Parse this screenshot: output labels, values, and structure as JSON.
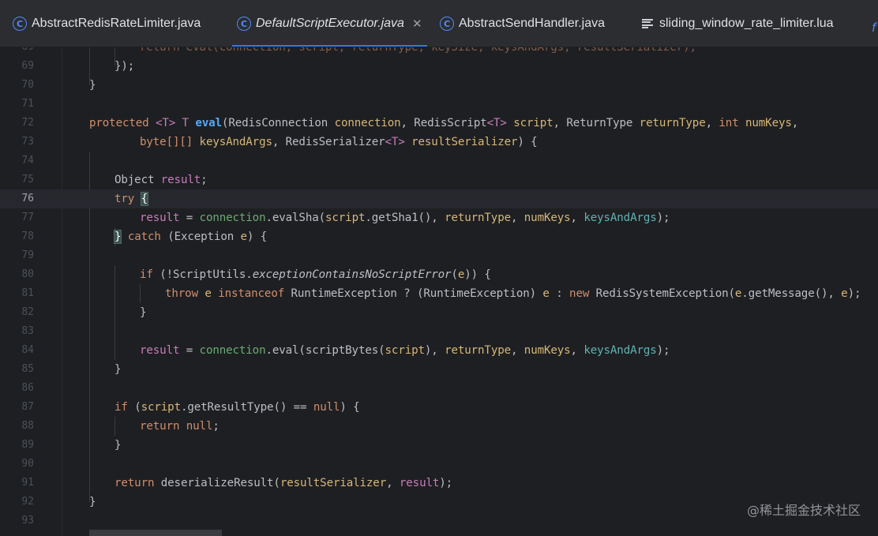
{
  "tabs": [
    {
      "label": "AbstractRedisRateLimiter.java",
      "icon": "java-class-icon"
    },
    {
      "label": "DefaultScriptExecutor.java",
      "icon": "java-class-icon",
      "active": true
    },
    {
      "label": "AbstractSendHandler.java",
      "icon": "java-class-icon"
    },
    {
      "label": "sliding_window_rate_limiter.lua",
      "icon": "text-file-icon"
    }
  ],
  "close_glyph": "✕",
  "line_numbers": [
    "69",
    "70",
    "71",
    "72",
    "73",
    "74",
    "75",
    "76",
    "77",
    "78",
    "79",
    "80",
    "81",
    "82",
    "83",
    "84",
    "85",
    "86",
    "87",
    "88",
    "89",
    "90",
    "91",
    "92",
    "93"
  ],
  "code": {
    "l69": "return eval(connection, script, returnType, keySize, keysAndArgs, resultSerializer);",
    "l69b": "});",
    "l70": "}",
    "l72a": "protected",
    "l72b": "<T>",
    "l72c": "T",
    "l72d": "eval",
    "l72e": "(RedisConnection",
    "l72f": "connection",
    "l72g": ", RedisScript",
    "l72h": "<T>",
    "l72i": "script",
    "l72j": ", ReturnType",
    "l72k": "returnType",
    "l72l": ",",
    "l72m": "int",
    "l72n": "numKeys",
    "l72o": ",",
    "l73a": "byte[][]",
    "l73b": "keysAndArgs",
    "l73c": ", RedisSerializer",
    "l73d": "<T>",
    "l73e": "resultSerializer",
    "l73f": ") {",
    "l75a": "Object",
    "l75b": "result",
    "l75c": ";",
    "l76a": "try",
    "l76b": "{",
    "l77a": "result",
    "l77b": " = ",
    "l77c": "connection",
    "l77d": ".evalSha(",
    "l77e": "script",
    "l77f": ".getSha1(), ",
    "l77g": "returnType",
    "l77h": ", ",
    "l77i": "numKeys",
    "l77j": ", ",
    "l77k": "keysAndArgs",
    "l77l": ");",
    "l78a": "}",
    "l78b": "catch",
    "l78c": "(Exception",
    "l78d": "e",
    "l78e": ") {",
    "l80a": "if",
    "l80b": "(!ScriptUtils.",
    "l80c": "exceptionContainsNoScriptError",
    "l80d": "(",
    "l80e": "e",
    "l80f": ")) {",
    "l81a": "throw",
    "l81b": "e",
    "l81c": "instanceof",
    "l81d": "RuntimeException ? (RuntimeException)",
    "l81e": "e",
    "l81f": ":",
    "l81g": "new",
    "l81h": "RedisSystemException(",
    "l81i": "e",
    "l81j": ".getMessage(), ",
    "l81k": "e",
    "l81l": ");",
    "l82": "}",
    "l84a": "result",
    "l84b": " = ",
    "l84c": "connection",
    "l84d": ".eval(scriptBytes(",
    "l84e": "script",
    "l84f": "), ",
    "l84g": "returnType",
    "l84h": ", ",
    "l84i": "numKeys",
    "l84j": ", ",
    "l84k": "keysAndArgs",
    "l84l": ");",
    "l85": "}",
    "l87a": "if",
    "l87b": "(",
    "l87c": "script",
    "l87d": ".getResultType() == ",
    "l87e": "null",
    "l87f": ") {",
    "l88a": "return",
    "l88b": "null",
    "l88c": ";",
    "l89": "}",
    "l91a": "return",
    "l91b": "deserializeResult(",
    "l91c": "resultSerializer",
    "l91d": ", ",
    "l91e": "result",
    "l91f": ");",
    "l92": "}"
  },
  "watermark": "@稀土掘金技术社区",
  "colors": {
    "accent": "#3574f0",
    "background": "#1e1f22",
    "keyword": "#cf8e6d",
    "method": "#56a8f5"
  }
}
